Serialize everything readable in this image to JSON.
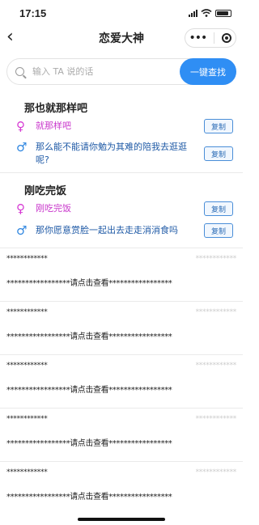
{
  "status": {
    "time": "17:15"
  },
  "nav": {
    "title": "恋爱大神",
    "more": "•••"
  },
  "search": {
    "placeholder": "输入 TA 说的话",
    "button": "一键查找"
  },
  "groups": [
    {
      "title": "那也就那样吧",
      "replies": [
        {
          "gender": "female",
          "text": "就那样吧",
          "copy": "复制"
        },
        {
          "gender": "male",
          "text": "那么能不能请你勉为其难的陪我去逛逛呢?",
          "copy": "复制"
        }
      ]
    },
    {
      "title": "刚吃完饭",
      "replies": [
        {
          "gender": "female",
          "text": "刚吃完饭",
          "copy": "复制"
        },
        {
          "gender": "male",
          "text": "那你愿意赏脸一起出去走走消消食吗",
          "copy": "复制"
        }
      ]
    }
  ],
  "locked": [
    {
      "title": "************",
      "tag": "************",
      "mask": "*****************请点击查看*****************"
    },
    {
      "title": "************",
      "tag": "************",
      "mask": "*****************请点击查看*****************"
    },
    {
      "title": "************",
      "tag": "************",
      "mask": "*****************请点击查看*****************"
    },
    {
      "title": "************",
      "tag": "************",
      "mask": "*****************请点击查看*****************"
    },
    {
      "title": "************",
      "tag": "************",
      "mask": "*****************请点击查看*****************"
    }
  ]
}
